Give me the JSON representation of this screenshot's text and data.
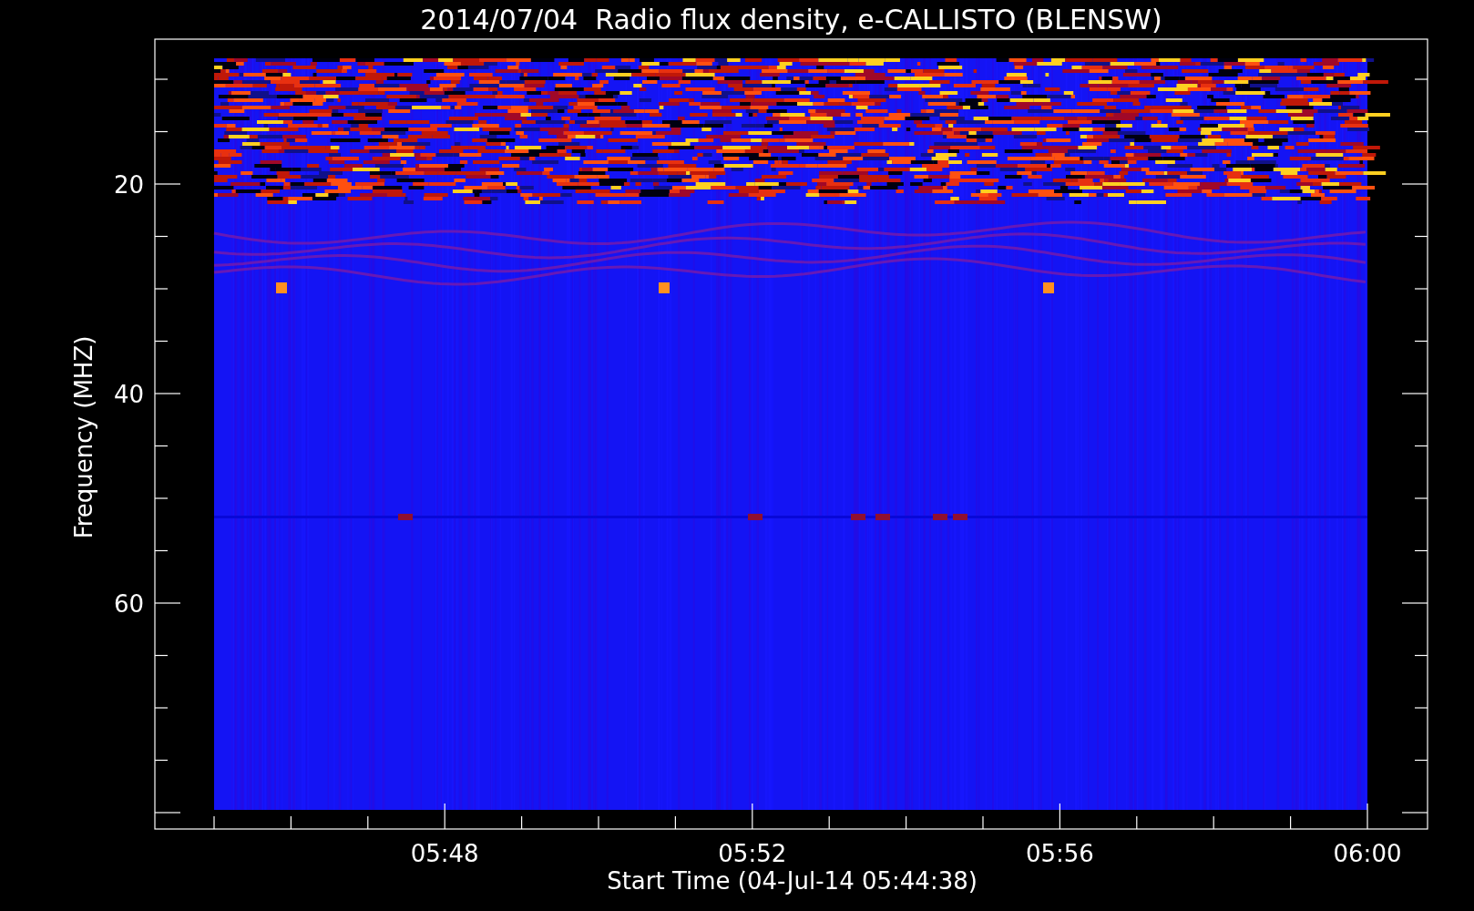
{
  "title": "2014/07/04  Radio flux density, e-CALLISTO (BLENSW)",
  "y_axis": {
    "label": "Frequency (MHZ)",
    "ticks": [
      "20",
      "40",
      "60"
    ]
  },
  "x_axis": {
    "label": "Start Time (04-Jul-14 05:44:38)",
    "ticks": [
      "05:48",
      "05:52",
      "05:56",
      "06:00"
    ]
  }
}
